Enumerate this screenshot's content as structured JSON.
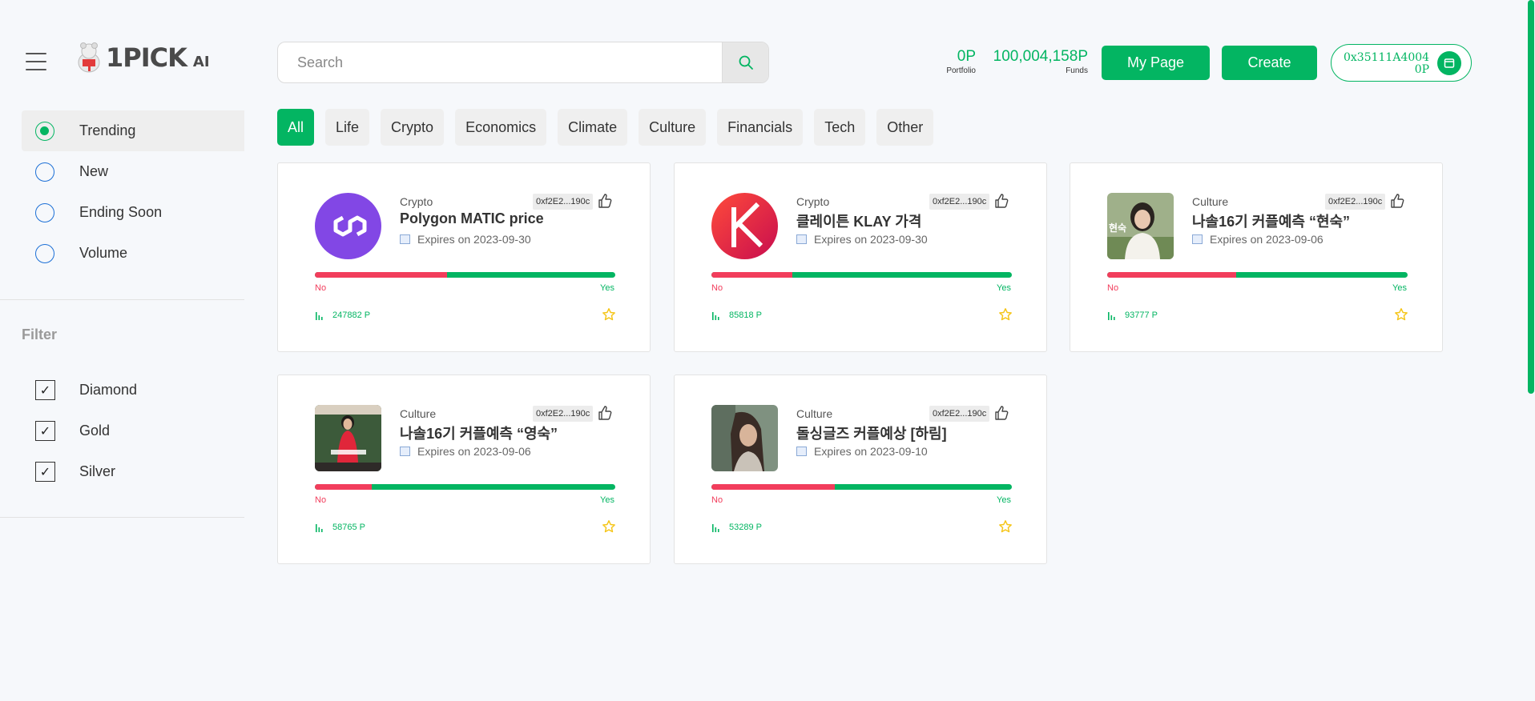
{
  "brand": {
    "name": "1PICK",
    "suffix": "AI"
  },
  "search": {
    "placeholder": "Search"
  },
  "header": {
    "portfolio": {
      "value": "0P",
      "label": "Portfolio"
    },
    "funds": {
      "value": "100,004,158P",
      "label": "Funds"
    },
    "my_page": "My Page",
    "create": "Create",
    "wallet": {
      "address": "0x35111A4004",
      "balance": "0P"
    }
  },
  "sidebar": {
    "sort": [
      {
        "label": "Trending",
        "active": true
      },
      {
        "label": "New",
        "active": false
      },
      {
        "label": "Ending Soon",
        "active": false
      },
      {
        "label": "Volume",
        "active": false
      }
    ],
    "filter_title": "Filter",
    "filters": [
      {
        "label": "Diamond",
        "checked": true
      },
      {
        "label": "Gold",
        "checked": true
      },
      {
        "label": "Silver",
        "checked": true
      }
    ]
  },
  "tabs": [
    "All",
    "Life",
    "Crypto",
    "Economics",
    "Climate",
    "Culture",
    "Financials",
    "Tech",
    "Other"
  ],
  "colors": {
    "accent": "#03b562",
    "no": "#f23d5c",
    "star": "#f5c518"
  },
  "cards": [
    {
      "category": "Crypto",
      "title": "Polygon MATIC price",
      "expires": "Expires on 2023-09-30",
      "creator": "0xf2E2...190c",
      "no": "No",
      "yes": "Yes",
      "no_share": 0.44,
      "volume": "247882 P",
      "image": "polygon-logo"
    },
    {
      "category": "Crypto",
      "title": "클레이튼 KLAY 가격",
      "expires": "Expires on 2023-09-30",
      "creator": "0xf2E2...190c",
      "no": "No",
      "yes": "Yes",
      "no_share": 0.27,
      "volume": "85818 P",
      "image": "klaytn-logo"
    },
    {
      "category": "Culture",
      "title": "나솔16기 커플예측 “현숙”",
      "expires": "Expires on 2023-09-06",
      "creator": "0xf2E2...190c",
      "no": "No",
      "yes": "Yes",
      "no_share": 0.43,
      "volume": "93777 P",
      "image": "photo-woman-white"
    },
    {
      "category": "Culture",
      "title": "나솔16기 커플예측 “영숙”",
      "expires": "Expires on 2023-09-06",
      "creator": "0xf2E2...190c",
      "no": "No",
      "yes": "Yes",
      "no_share": 0.19,
      "volume": "58765 P",
      "image": "photo-woman-red"
    },
    {
      "category": "Culture",
      "title": "돌싱글즈 커플예상 [하림]",
      "expires": "Expires on 2023-09-10",
      "creator": "0xf2E2...190c",
      "no": "No",
      "yes": "Yes",
      "no_share": 0.41,
      "volume": "53289 P",
      "image": "photo-woman-dark"
    }
  ]
}
